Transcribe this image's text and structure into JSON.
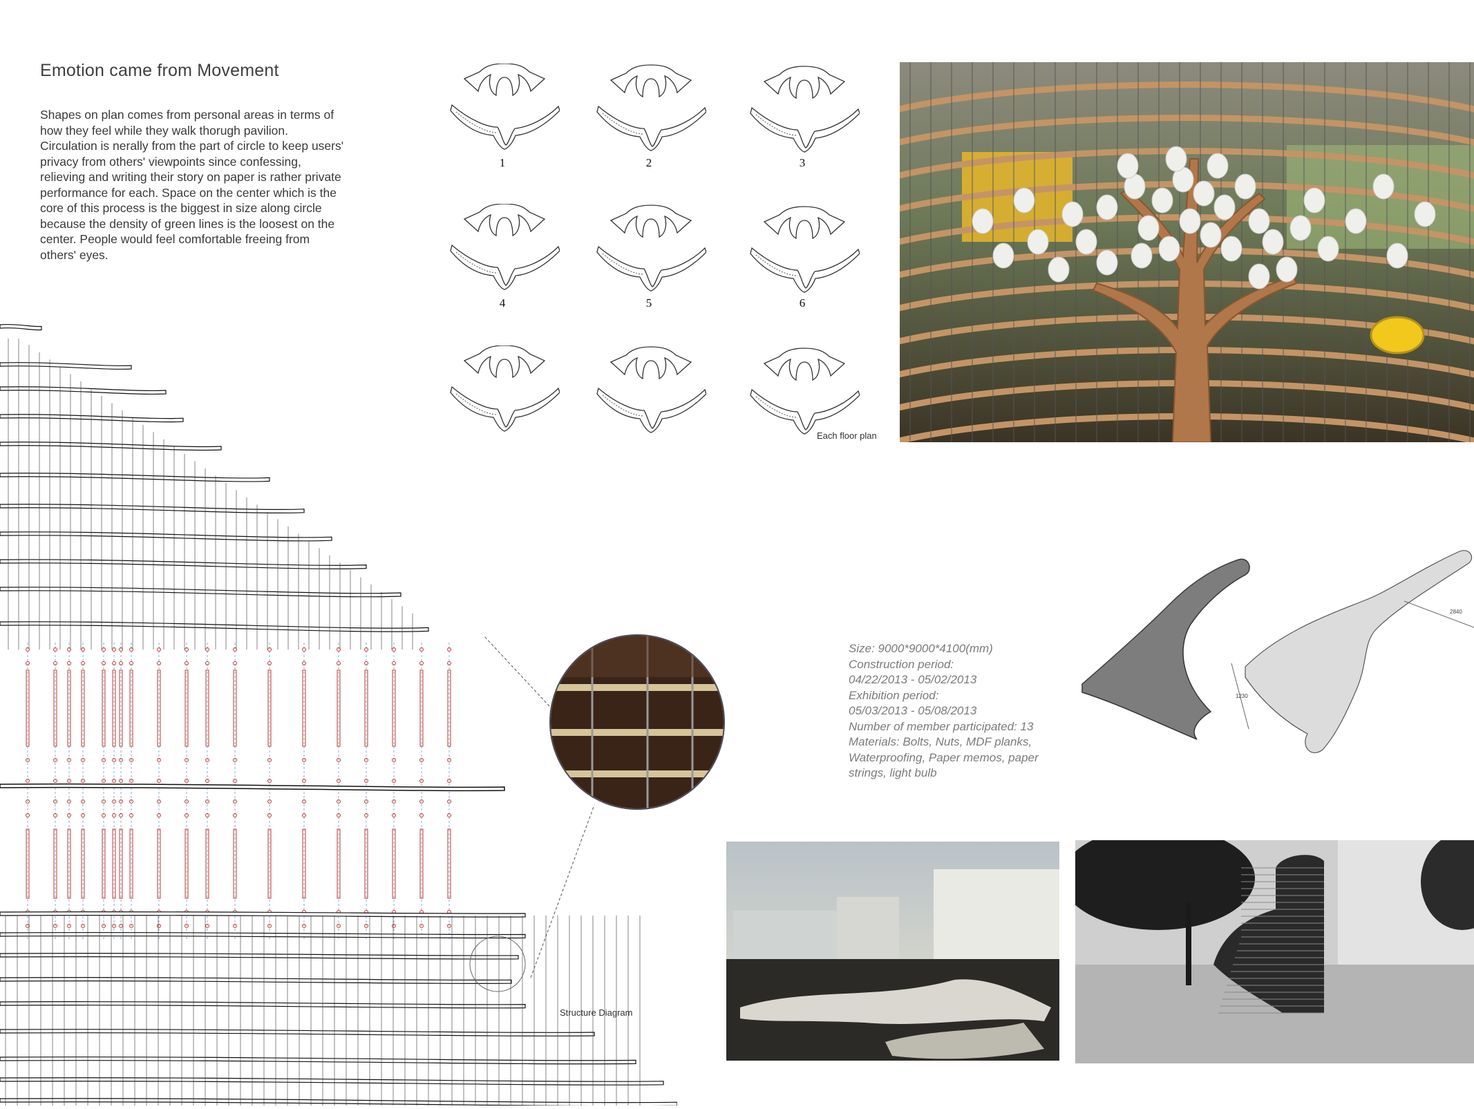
{
  "heading": {
    "title": "Emotion came from Movement",
    "description": "Shapes on plan comes from personal areas in terms of how they feel while they walk thorugh pavilion. Circulation is nerally from the part of circle to keep users' privacy from others' viewpoints since confessing, relieving and writing their story on paper is rather private performance for each. Space on the center which is the core of this process is the biggest in size along circle because the density of green lines is the loosest on the center. People would feel comfortable freeing from others' eyes."
  },
  "floor_plans": {
    "numbers": [
      "1",
      "2",
      "3",
      "4",
      "5",
      "6"
    ],
    "caption": "Each floor plan"
  },
  "structure": {
    "caption": "Structure Diagram"
  },
  "specs": {
    "lines": [
      "Size: 9000*9000*4100(mm)",
      "Construction period:",
      "04/22/2013 - 05/02/2013",
      "Exhibition period:",
      "05/03/2013 - 05/08/2013",
      "Number of member participated: 13",
      "Materials: Bolts, Nuts, MDF planks,",
      "Waterproofing, Paper memos, paper",
      "strings, light bulb"
    ]
  },
  "part_dims": {
    "length": "2840",
    "width": "1230"
  },
  "colors": {
    "wood": "#a0643a",
    "rod_red": "#c0392b",
    "guide_blue": "#3a6fc4",
    "lines": "#222222"
  }
}
